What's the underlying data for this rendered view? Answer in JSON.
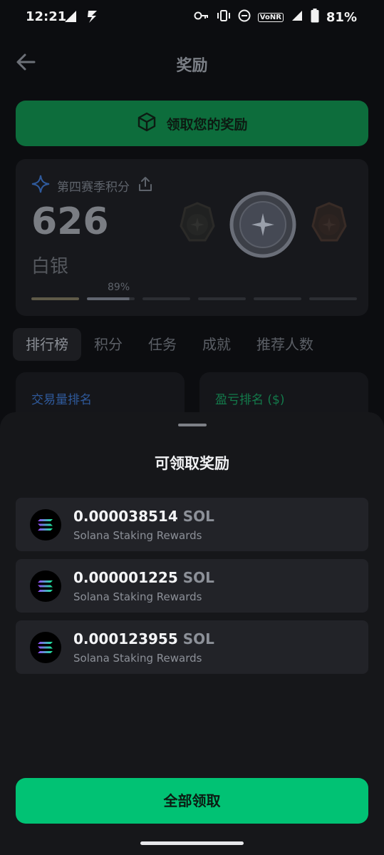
{
  "status_bar": {
    "time": "12:21",
    "vonr_label": "VoNR",
    "battery_percent": "81%"
  },
  "header": {
    "title": "奖励"
  },
  "claim_banner": {
    "label": "领取您的奖励"
  },
  "season": {
    "label": "第四赛季积分",
    "points": "626",
    "tier": "白银",
    "progress_percent_label": "89%",
    "progress_value": 0.89
  },
  "tabs": [
    {
      "label": "排行榜"
    },
    {
      "label": "积分"
    },
    {
      "label": "任务"
    },
    {
      "label": "成就"
    },
    {
      "label": "推荐人数"
    }
  ],
  "rank_cards": {
    "volume_label": "交易量排名",
    "pnl_label": "盈亏排名 ($)"
  },
  "sheet": {
    "title": "可领取奖励",
    "rewards": [
      {
        "amount": "0.000038514",
        "unit": "SOL",
        "desc": "Solana Staking Rewards",
        "icon": "solana-icon"
      },
      {
        "amount": "0.000001225",
        "unit": "SOL",
        "desc": "Solana Staking Rewards",
        "icon": "solana-icon"
      },
      {
        "amount": "0.000123955",
        "unit": "SOL",
        "desc": "Solana Staking Rewards",
        "icon": "solana-icon"
      }
    ],
    "claim_all_label": "全部领取"
  },
  "colors": {
    "accent_green": "#01c274",
    "banner_green": "#0d6d3c",
    "volume_rank_blue": "#2f5a9c",
    "pnl_rank_green": "#137a4b"
  }
}
